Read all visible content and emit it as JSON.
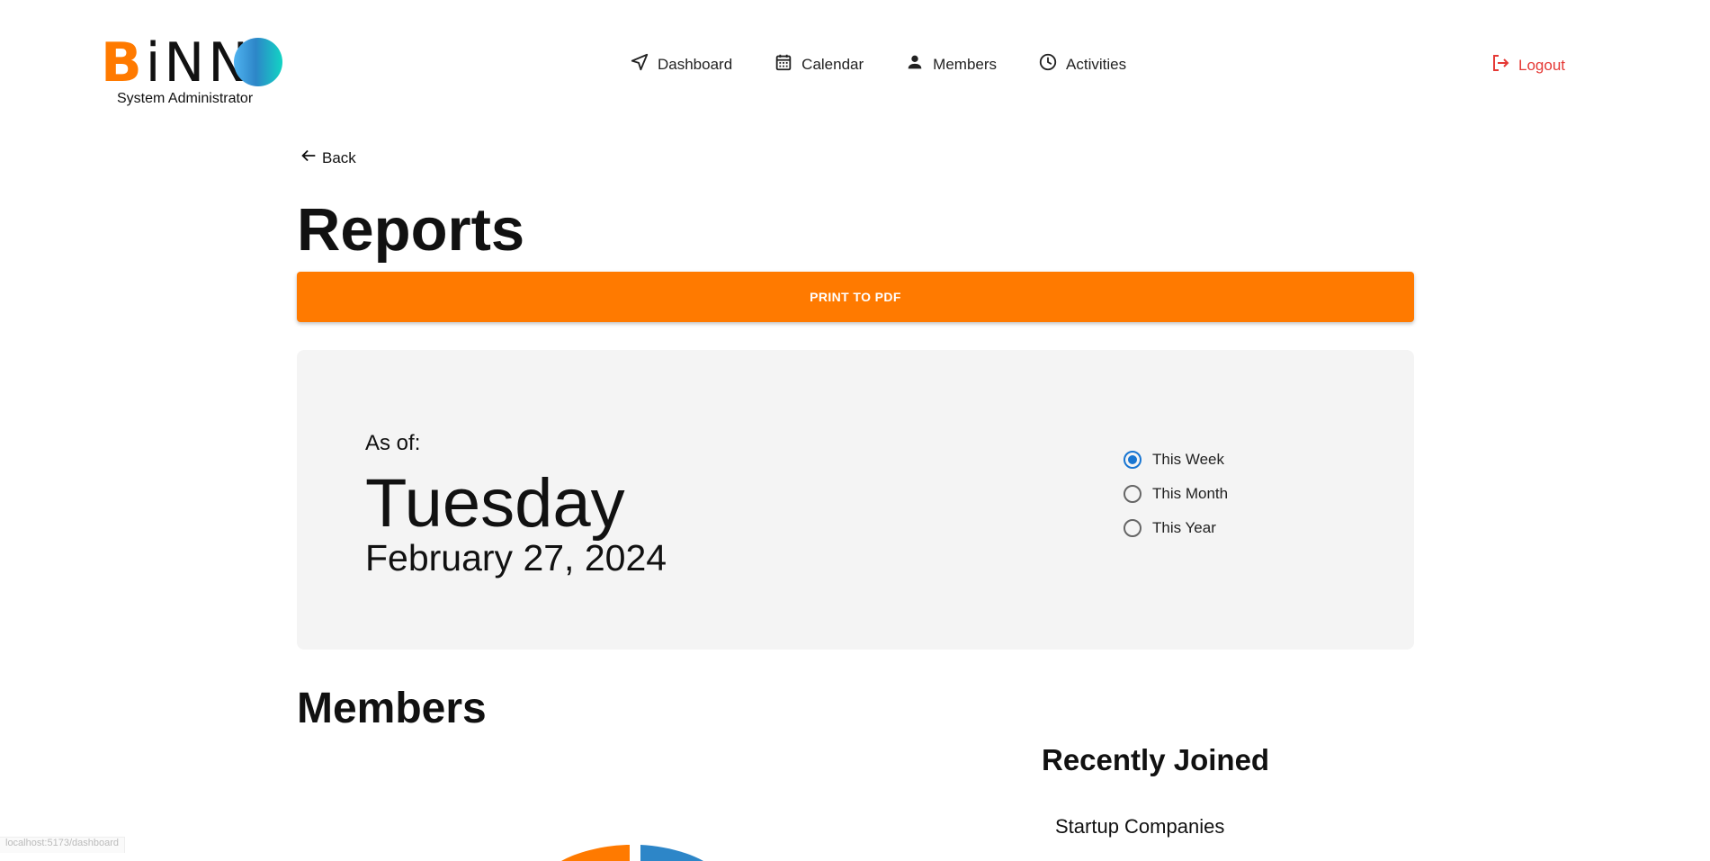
{
  "brand": {
    "logo_text_b": "B",
    "logo_text_rest": "iNN",
    "logo_text_o": "O",
    "subtitle": "System Administrator",
    "accent": "#ff7a00",
    "logo_gradient": [
      "#4fb3f0",
      "#2d86c8",
      "#12d4c4"
    ]
  },
  "nav": {
    "items": [
      {
        "label": "Dashboard",
        "icon": "navigation-arrow-icon"
      },
      {
        "label": "Calendar",
        "icon": "calendar-icon"
      },
      {
        "label": "Members",
        "icon": "person-icon"
      },
      {
        "label": "Activities",
        "icon": "clock-icon"
      }
    ],
    "logout": {
      "label": "Logout",
      "icon": "logout-icon",
      "color": "#e53935"
    }
  },
  "page": {
    "back_label": "Back",
    "title": "Reports",
    "print_label": "PRINT TO PDF"
  },
  "as_of": {
    "label": "As of:",
    "day": "Tuesday",
    "date": "February 27, 2024"
  },
  "period": {
    "options": [
      "This Week",
      "This Month",
      "This Year"
    ],
    "selected": "This Week",
    "selected_color": "#1976d2"
  },
  "members_section": {
    "title": "Members",
    "recently_joined_title": "Recently Joined",
    "recently_joined_subtitle": "Startup Companies",
    "pie_colors": [
      "#ff7a00",
      "#2d86c8"
    ]
  },
  "status_bar": {
    "url": "localhost:5173/dashboard"
  }
}
